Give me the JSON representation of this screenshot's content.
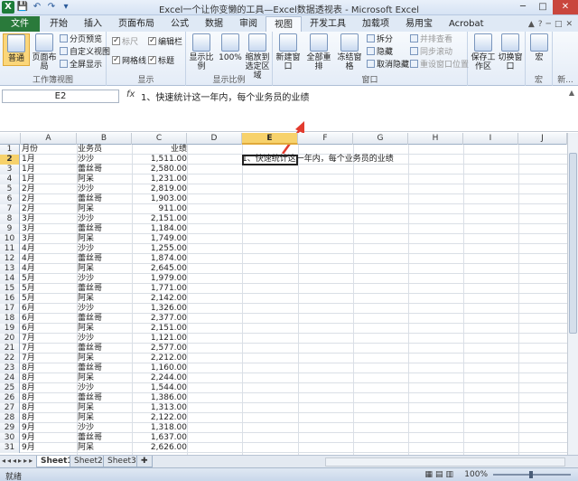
{
  "window": {
    "title": "Excel一个让你变懒的工具—Excel数据透视表 - Microsoft Excel",
    "controls": [
      "─",
      "□",
      "✕"
    ]
  },
  "qat": [
    "X",
    "💾",
    "↶",
    "↷",
    "▾"
  ],
  "tabs": [
    "文件",
    "开始",
    "插入",
    "页面布局",
    "公式",
    "数据",
    "审阅",
    "视图",
    "开发工具",
    "加载项",
    "易用宝",
    "Acrobat"
  ],
  "tab_icons": [
    "▲",
    "?",
    "─",
    "□",
    "✕"
  ],
  "ribbon": {
    "workbook_views": {
      "label": "工作簿视图",
      "normal": "普通",
      "page_layout": "页面布局",
      "page_break": "分页预览",
      "custom_views": "自定义视图",
      "full_screen": "全屏显示"
    },
    "show": {
      "label": "显示",
      "ruler": "标尺",
      "gridlines": "网格线",
      "formula_bar": "编辑栏",
      "headings": "标题"
    },
    "zoom": {
      "label": "显示比例",
      "zoom": "显示比例",
      "hundred": "100%",
      "selection": "缩放到选定区域"
    },
    "window": {
      "label": "窗口",
      "new_window": "新建窗口",
      "arrange_all": "全部重排",
      "freeze_panes": "冻结窗格",
      "split": "拆分",
      "hide": "隐藏",
      "unhide": "取消隐藏",
      "side_by_side": "并排查看",
      "sync_scroll": "同步滚动",
      "reset_position": "重设窗口位置",
      "save_workspace": "保存工作区",
      "switch_windows": "切换窗口"
    },
    "macros": {
      "label": "宏",
      "macros": "宏"
    },
    "more_label": "新..."
  },
  "formula_bar": {
    "name_box": "E2",
    "fx": "fx",
    "content": "1、快速统计这一年内，每个业务员的业绩"
  },
  "columns": [
    "A",
    "B",
    "C",
    "D",
    "E",
    "F",
    "G",
    "H",
    "I",
    "J"
  ],
  "selected_cell": "E2",
  "rows": [
    {
      "n": "1",
      "a": "月份",
      "b": "业务员",
      "c": "业绩"
    },
    {
      "n": "2",
      "a": "1月",
      "b": "沙沙",
      "c": "1,511.00",
      "e": "1、快速统计这一年内，每个业务员的业绩"
    },
    {
      "n": "3",
      "a": "1月",
      "b": "蕾丝哥",
      "c": "2,580.00"
    },
    {
      "n": "4",
      "a": "1月",
      "b": "阿呆",
      "c": "1,231.00"
    },
    {
      "n": "5",
      "a": "2月",
      "b": "沙沙",
      "c": "2,819.00"
    },
    {
      "n": "6",
      "a": "2月",
      "b": "蕾丝哥",
      "c": "1,903.00"
    },
    {
      "n": "7",
      "a": "2月",
      "b": "阿呆",
      "c": "911.00"
    },
    {
      "n": "8",
      "a": "3月",
      "b": "沙沙",
      "c": "2,151.00"
    },
    {
      "n": "9",
      "a": "3月",
      "b": "蕾丝哥",
      "c": "1,184.00"
    },
    {
      "n": "10",
      "a": "3月",
      "b": "阿呆",
      "c": "1,749.00"
    },
    {
      "n": "11",
      "a": "4月",
      "b": "沙沙",
      "c": "1,255.00"
    },
    {
      "n": "12",
      "a": "4月",
      "b": "蕾丝哥",
      "c": "1,874.00"
    },
    {
      "n": "13",
      "a": "4月",
      "b": "阿呆",
      "c": "2,645.00"
    },
    {
      "n": "14",
      "a": "5月",
      "b": "沙沙",
      "c": "1,979.00"
    },
    {
      "n": "15",
      "a": "5月",
      "b": "蕾丝哥",
      "c": "1,771.00"
    },
    {
      "n": "16",
      "a": "5月",
      "b": "阿呆",
      "c": "2,142.00"
    },
    {
      "n": "17",
      "a": "6月",
      "b": "沙沙",
      "c": "1,326.00"
    },
    {
      "n": "18",
      "a": "6月",
      "b": "蕾丝哥",
      "c": "2,377.00"
    },
    {
      "n": "19",
      "a": "6月",
      "b": "阿呆",
      "c": "2,151.00"
    },
    {
      "n": "20",
      "a": "7月",
      "b": "沙沙",
      "c": "1,121.00"
    },
    {
      "n": "21",
      "a": "7月",
      "b": "蕾丝哥",
      "c": "2,577.00"
    },
    {
      "n": "22",
      "a": "7月",
      "b": "阿呆",
      "c": "2,212.00"
    },
    {
      "n": "23",
      "a": "8月",
      "b": "蕾丝哥",
      "c": "1,160.00"
    },
    {
      "n": "24",
      "a": "8月",
      "b": "阿呆",
      "c": "2,244.00"
    },
    {
      "n": "25",
      "a": "8月",
      "b": "沙沙",
      "c": "1,544.00"
    },
    {
      "n": "26",
      "a": "8月",
      "b": "蕾丝哥",
      "c": "1,386.00"
    },
    {
      "n": "27",
      "a": "8月",
      "b": "阿呆",
      "c": "1,313.00"
    },
    {
      "n": "28",
      "a": "8月",
      "b": "阿呆",
      "c": "2,122.00"
    },
    {
      "n": "29",
      "a": "9月",
      "b": "沙沙",
      "c": "1,318.00"
    },
    {
      "n": "30",
      "a": "9月",
      "b": "蕾丝哥",
      "c": "1,637.00"
    },
    {
      "n": "31",
      "a": "9月",
      "b": "阿呆",
      "c": "2,626.00"
    }
  ],
  "sheets": [
    "Sheet1",
    "Sheet2",
    "Sheet3"
  ],
  "active_sheet": "Sheet1",
  "status": {
    "ready": "就绪",
    "zoom": "100%"
  },
  "colors": {
    "file_tab": "#2a7a3b",
    "selection": "#f7d26c",
    "arrow": "#e23b2e"
  }
}
